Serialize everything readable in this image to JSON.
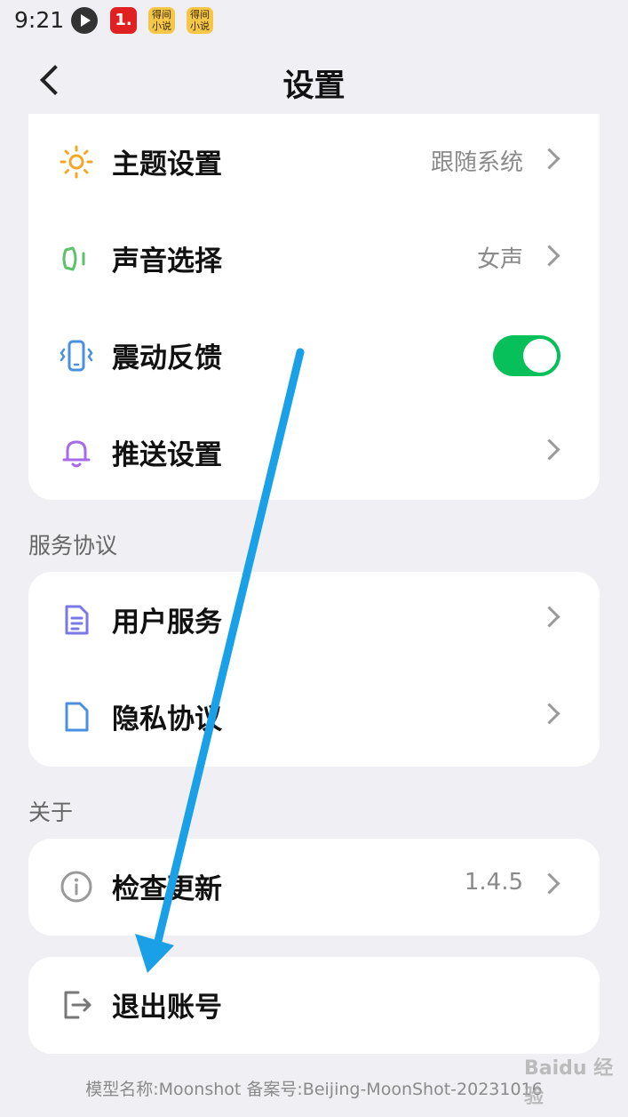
{
  "status_bar": {
    "time": "9:21",
    "app_icon_2": "1.",
    "app_icon_3": "得间\n小说",
    "app_icon_4": "得间\n小说"
  },
  "nav": {
    "title": "设置",
    "back_icon": "chevron-left-icon"
  },
  "settings": {
    "items": [
      {
        "label": "主题设置",
        "value": "跟随系统",
        "icon": "sun-icon",
        "icon_color": "#f5a623"
      },
      {
        "label": "声音选择",
        "value": "女声",
        "icon": "speaker-icon",
        "icon_color": "#5cc26a"
      },
      {
        "label": "震动反馈",
        "toggle_on": true,
        "icon": "vibration-icon",
        "icon_color": "#4a90e2"
      },
      {
        "label": "推送设置",
        "icon": "bell-icon",
        "icon_color": "#a86be8"
      }
    ]
  },
  "service": {
    "header": "服务协议",
    "items": [
      {
        "label": "用户服务",
        "icon": "document-icon",
        "icon_color": "#7a78e6"
      },
      {
        "label": "隐私协议",
        "icon": "file-icon",
        "icon_color": "#4a90e2"
      }
    ]
  },
  "about": {
    "header": "关于",
    "items": [
      {
        "label": "检查更新",
        "value": "1.4.5",
        "icon": "info-icon",
        "icon_color": "#999999"
      }
    ]
  },
  "logout": {
    "label": "退出账号",
    "icon": "logout-icon",
    "icon_color": "#777777"
  },
  "footer": {
    "text": "模型名称:Moonshot 备案号:Beijing-MoonShot-20231016"
  },
  "watermark": {
    "text": "Baidu 经验"
  },
  "annotation": {
    "arrow_color": "#1aa0e6"
  }
}
